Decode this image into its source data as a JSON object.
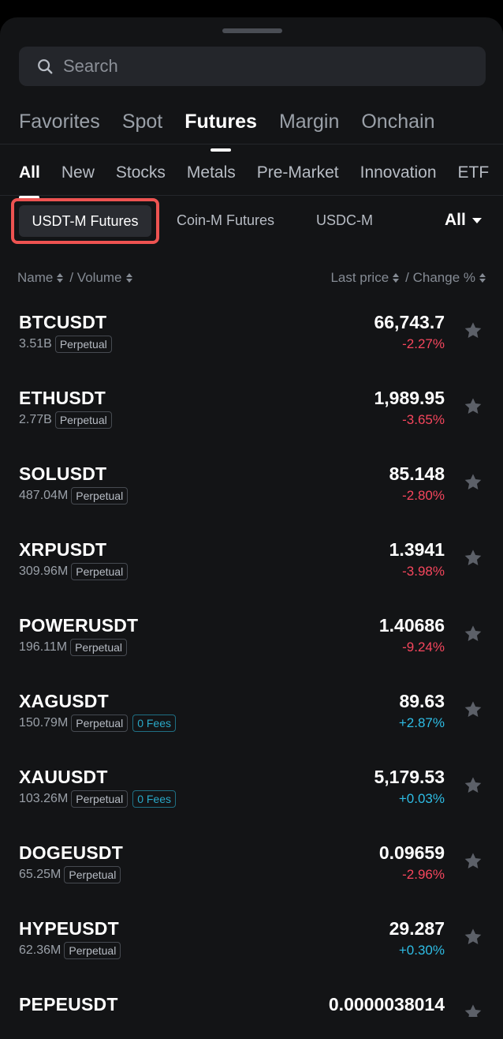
{
  "search": {
    "placeholder": "Search"
  },
  "main_tabs": [
    {
      "label": "Favorites"
    },
    {
      "label": "Spot"
    },
    {
      "label": "Futures",
      "active": true
    },
    {
      "label": "Margin"
    },
    {
      "label": "Onchain"
    }
  ],
  "sub_tabs": [
    {
      "label": "All",
      "active": true
    },
    {
      "label": "New"
    },
    {
      "label": "Stocks"
    },
    {
      "label": "Metals"
    },
    {
      "label": "Pre-Market"
    },
    {
      "label": "Innovation"
    },
    {
      "label": "ETF"
    }
  ],
  "filters": {
    "selected": "USDT-M Futures",
    "options": [
      "Coin-M Futures",
      "USDC-M"
    ],
    "all_label": "All"
  },
  "columns": {
    "name": "Name",
    "volume": "/ Volume",
    "last_price": "Last price",
    "change": "/ Change %"
  },
  "tickers": [
    {
      "symbol": "BTCUSDT",
      "volume": "3.51B",
      "tags": [
        "Perpetual"
      ],
      "price": "66,743.7",
      "change": "-2.27%",
      "direction": "down"
    },
    {
      "symbol": "ETHUSDT",
      "volume": "2.77B",
      "tags": [
        "Perpetual"
      ],
      "price": "1,989.95",
      "change": "-3.65%",
      "direction": "down"
    },
    {
      "symbol": "SOLUSDT",
      "volume": "487.04M",
      "tags": [
        "Perpetual"
      ],
      "price": "85.148",
      "change": "-2.80%",
      "direction": "down"
    },
    {
      "symbol": "XRPUSDT",
      "volume": "309.96M",
      "tags": [
        "Perpetual"
      ],
      "price": "1.3941",
      "change": "-3.98%",
      "direction": "down"
    },
    {
      "symbol": "POWERUSDT",
      "volume": "196.11M",
      "tags": [
        "Perpetual"
      ],
      "price": "1.40686",
      "change": "-9.24%",
      "direction": "down"
    },
    {
      "symbol": "XAGUSDT",
      "volume": "150.79M",
      "tags": [
        "Perpetual",
        "0 Fees"
      ],
      "price": "89.63",
      "change": "+2.87%",
      "direction": "up"
    },
    {
      "symbol": "XAUUSDT",
      "volume": "103.26M",
      "tags": [
        "Perpetual",
        "0 Fees"
      ],
      "price": "5,179.53",
      "change": "+0.03%",
      "direction": "up"
    },
    {
      "symbol": "DOGEUSDT",
      "volume": "65.25M",
      "tags": [
        "Perpetual"
      ],
      "price": "0.09659",
      "change": "-2.96%",
      "direction": "down"
    },
    {
      "symbol": "HYPEUSDT",
      "volume": "62.36M",
      "tags": [
        "Perpetual"
      ],
      "price": "29.287",
      "change": "+0.30%",
      "direction": "up"
    },
    {
      "symbol": "PEPEUSDT",
      "volume": "",
      "tags": [],
      "price": "0.0000038014",
      "change": "",
      "direction": "down"
    }
  ],
  "colors": {
    "background": "#131416",
    "negative": "#f6465d",
    "positive": "#2ebde5",
    "highlight": "#ee5351"
  },
  "icons": {
    "search": "search-icon",
    "favorite": "star-icon",
    "dropdown": "caret-down-icon"
  }
}
